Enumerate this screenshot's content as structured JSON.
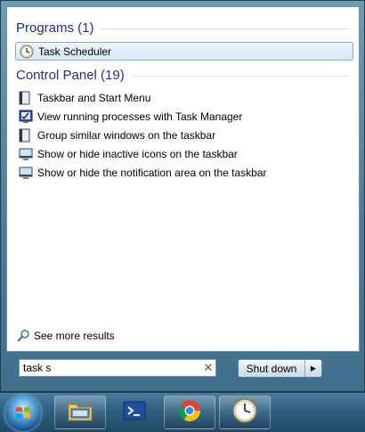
{
  "programs": {
    "header": "Programs (1)",
    "items": [
      {
        "label": "Task Scheduler",
        "icon": "clock-icon",
        "selected": true
      }
    ]
  },
  "control_panel": {
    "header": "Control Panel (19)",
    "items": [
      {
        "label": "Taskbar and Start Menu",
        "icon": "taskbar-icon"
      },
      {
        "label": "View running processes with Task Manager",
        "icon": "task-manager-icon"
      },
      {
        "label": "Group similar windows on the taskbar",
        "icon": "taskbar-icon"
      },
      {
        "label": "Show or hide inactive icons on the taskbar",
        "icon": "monitor-icon"
      },
      {
        "label": "Show or hide the notification area on the taskbar",
        "icon": "monitor-icon"
      }
    ]
  },
  "see_more": {
    "label": "See more results",
    "icon": "magnifier-icon"
  },
  "search": {
    "value": "task s",
    "clear_icon": "clear-x-icon"
  },
  "shutdown": {
    "label": "Shut down",
    "arrow_icon": "triangle-right-icon"
  },
  "taskbar": {
    "items": [
      {
        "name": "start-orb",
        "icon": "windows-logo-icon"
      },
      {
        "name": "explorer",
        "icon": "folder-icon"
      },
      {
        "name": "powershell",
        "icon": "powershell-icon"
      },
      {
        "name": "chrome",
        "icon": "chrome-icon"
      },
      {
        "name": "task-scheduler",
        "icon": "clock-icon"
      }
    ]
  }
}
